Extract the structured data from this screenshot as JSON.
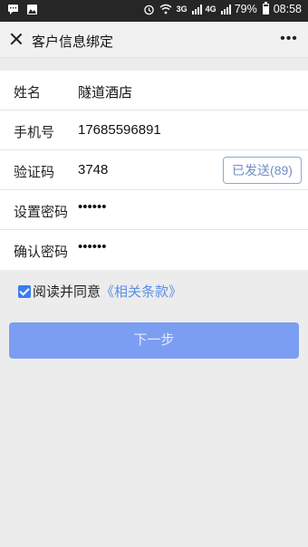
{
  "status_bar": {
    "battery": "79%",
    "time": "08:58",
    "network_1": "3G",
    "network_2": "4G"
  },
  "header": {
    "title": "客户信息绑定"
  },
  "form": {
    "name_label": "姓名",
    "name_value": "隧道酒店",
    "phone_label": "手机号",
    "phone_value": "17685596891",
    "code_label": "验证码",
    "code_value": "3748",
    "send_button": "已发送(89)",
    "password_label": "设置密码",
    "password_value": "••••••",
    "confirm_label": "确认密码",
    "confirm_value": "••••••"
  },
  "agreement": {
    "checked": true,
    "text": "阅读并同意",
    "link": "《相关条款》"
  },
  "next_button": "下一步",
  "colors": {
    "accent": "#7c9ef2",
    "link": "#5b8fe6",
    "status_bar": "#262626"
  }
}
